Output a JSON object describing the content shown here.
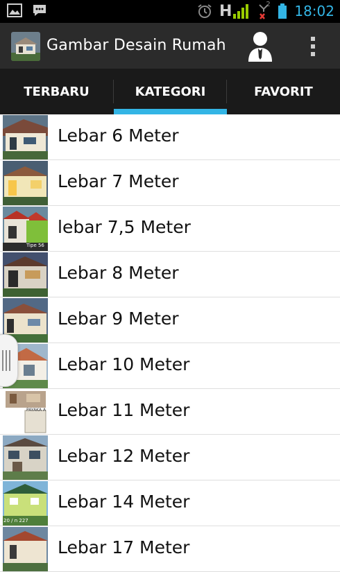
{
  "status_bar": {
    "time": "18:02",
    "network_label": "H",
    "sim2_label": "2",
    "icons": [
      "gallery-notification-icon",
      "chat-notification-icon",
      "alarm-icon",
      "signal-icon",
      "no-signal-sim2-icon",
      "battery-icon"
    ],
    "accent_color": "#33b5e5"
  },
  "action_bar": {
    "title": "Gambar Desain Rumah",
    "icons": [
      "app-logo-icon",
      "profile-icon",
      "overflow-menu-icon"
    ]
  },
  "tabs": [
    {
      "label": "TERBARU",
      "selected": false
    },
    {
      "label": "KATEGORI",
      "selected": true
    },
    {
      "label": "FAVORIT",
      "selected": false
    }
  ],
  "categories": [
    {
      "label": "Lebar 6 Meter"
    },
    {
      "label": "Lebar 7 Meter"
    },
    {
      "label": "lebar 7,5 Meter",
      "thumb_caption": "Tipe 56"
    },
    {
      "label": "Lebar 8 Meter"
    },
    {
      "label": "Lebar 9 Meter"
    },
    {
      "label": "Lebar 10 Meter"
    },
    {
      "label": "Lebar 11 Meter",
      "thumb_caption": "PAYAKA A"
    },
    {
      "label": "Lebar 12 Meter"
    },
    {
      "label": "Lebar 14 Meter",
      "thumb_caption": "20 / n 227"
    },
    {
      "label": "Lebar 17 Meter"
    }
  ]
}
